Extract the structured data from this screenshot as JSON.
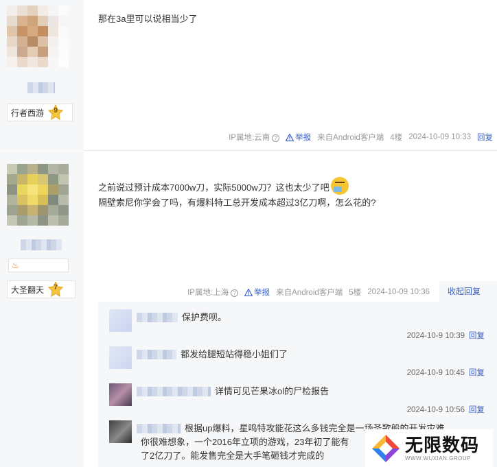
{
  "posts": [
    {
      "badge": {
        "title": "行者西游",
        "level": "9"
      },
      "content": [
        "那在3a里可以说相当少了"
      ],
      "meta": {
        "ip": "IP属地:云南",
        "report": "举报",
        "source": "来自Android客户端",
        "floor": "4楼",
        "time": "2024-10-09 10:33",
        "reply": "回复"
      }
    },
    {
      "badge": {
        "title": "大圣翻天",
        "level": "7"
      },
      "content": [
        "之前说过预计成本7000w刀，实际5000w刀？这也太少了吧",
        "隔壁索尼你学会了吗，有爆料特工总开发成本超过3亿刀啊，怎么花的?"
      ],
      "meta": {
        "ip": "IP属地:上海",
        "report": "举报",
        "source": "来自Android客户端",
        "floor": "5楼",
        "time": "2024-10-09 10:36",
        "reply_tab": "收起回复"
      },
      "sub_replies": [
        {
          "text": "保护费呗。",
          "time": "2024-10-9 10:39",
          "reply": "回复"
        },
        {
          "text": "都发给腿短站得稳小姐们了",
          "time": "2024-10-9 10:45",
          "reply": "回复"
        },
        {
          "text": "详情可见芒果冰ol的尸检报告",
          "time": "2024-10-9 10:56",
          "reply": "回复"
        },
        {
          "text_lines": [
            "根据up爆料，星鸣特攻能花这么多钱完全是一场圣歌般的开发灾难，",
            "你很难想象，一个2016年立项的游戏，23年初了能有",
            "了2亿刀了。能发售完全是大手笔砸钱才完成的"
          ]
        }
      ]
    }
  ],
  "watermark": {
    "brand": "无限数码",
    "sub": "WWW.WUXIAN.GROUP"
  },
  "colors": {
    "link": "#3b62c6",
    "meta": "#999999",
    "sidebar": "#f6f7f9"
  }
}
